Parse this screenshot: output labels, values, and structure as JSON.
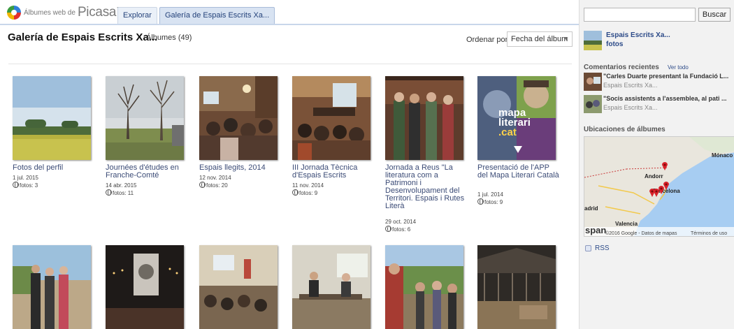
{
  "header_bar": {
    "brand_small": "Álbumes web de",
    "brand_picasa": "Picasa",
    "brand_tm": "™",
    "tabs": [
      {
        "label": "Explorar"
      },
      {
        "label": "Galería de Espais Escrits Xa..."
      }
    ]
  },
  "gallery": {
    "title": "Galería de Espais Escrits Xa...",
    "count": "Álbumes (49)",
    "sort_label": "Ordenar por:",
    "sort_value": "Fecha del álbum"
  },
  "albums": [
    {
      "name": "Fotos del perfil",
      "date": "1 jul. 2015",
      "photos": "fotos: 3"
    },
    {
      "name": "Journées d'études en Franche-Comté",
      "date": "14 abr. 2015",
      "photos": "fotos: 11"
    },
    {
      "name": "Espais llegits, 2014",
      "date": "12 nov. 2014",
      "photos": "fotos: 20"
    },
    {
      "name": "III Jornada Tècnica d'Espais Escrits",
      "date": "11 nov. 2014",
      "photos": "fotos: 9"
    },
    {
      "name": "Jornada a Reus \"La literatura com a Patrimoni i Desenvolupament del Territori. Espais i Rutes Literà",
      "date": "29 oct. 2014",
      "photos": "fotos: 6"
    },
    {
      "name": "Presentació de l'APP del Mapa Literari Català",
      "date": "1 jul. 2014",
      "photos": "fotos: 9"
    },
    {
      "name": "",
      "date": "",
      "photos": ""
    },
    {
      "name": "",
      "date": "",
      "photos": ""
    },
    {
      "name": "",
      "date": "",
      "photos": ""
    },
    {
      "name": "",
      "date": "",
      "photos": ""
    },
    {
      "name": "",
      "date": "",
      "photos": ""
    },
    {
      "name": "",
      "date": "",
      "photos": ""
    }
  ],
  "app_badge": {
    "line1": "mapa",
    "line2": "literari",
    "line3": ".cat"
  },
  "sidebar": {
    "search_placeholder": "",
    "search_button": "Buscar",
    "owner_name": "Espais Escrits Xa...",
    "owner_sub": "fotos",
    "recent_title": "Comentarios recientes",
    "recent_link": "Ver todo",
    "comments": [
      {
        "text": "\"Carles Duarte presentant la Fundació L...",
        "author": "Espais Escrits Xa..."
      },
      {
        "text": "\"Socis assistents a l'assemblea, al pati ...",
        "author": "Espais Escrits Xa..."
      }
    ],
    "locations_title": "Ubicaciones de álbumes",
    "map": {
      "labels": [
        "Andorr",
        "Barcelona",
        "Mónaco",
        "adrid",
        "Valencia"
      ],
      "brand": "span",
      "copyright": "©2016 Google - Datos de mapas",
      "terms": "Términos de uso"
    },
    "rss": "RSS"
  },
  "colors": {
    "link": "#3b4b76",
    "tab_bg": "#eaf0f8",
    "accent_line": "#c8d6ea"
  }
}
